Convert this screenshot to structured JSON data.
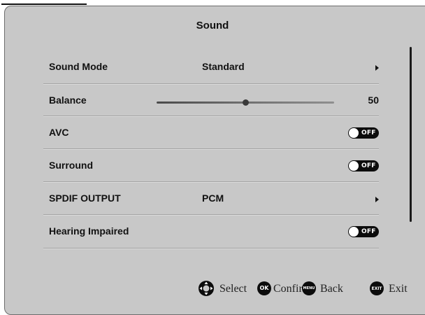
{
  "menu": {
    "title": "Sound",
    "items": [
      {
        "label": "Sound Mode",
        "value": "Standard"
      },
      {
        "label": "Balance",
        "value": "50",
        "level": 0.5
      },
      {
        "label": "AVC",
        "state": "OFF"
      },
      {
        "label": "Surround",
        "state": "OFF"
      },
      {
        "label": "SPDIF OUTPUT",
        "value": "PCM"
      },
      {
        "label": "Hearing Impaired",
        "state": "OFF"
      }
    ]
  },
  "footer": {
    "select": {
      "icon": "dpad-icon",
      "label": "Select"
    },
    "confirm": {
      "icon": "ok-button-icon",
      "badge": "OK",
      "label": "Confir"
    },
    "back": {
      "icon": "menu-button-icon",
      "badge": "MENU",
      "label": "Back"
    },
    "exit": {
      "icon": "exit-button-icon",
      "badge": "EXIT",
      "label": "Exit"
    }
  },
  "colors": {
    "panel_background": "#c8c8c8",
    "text": "#111111",
    "toggle_background": "#0c0c0c"
  }
}
